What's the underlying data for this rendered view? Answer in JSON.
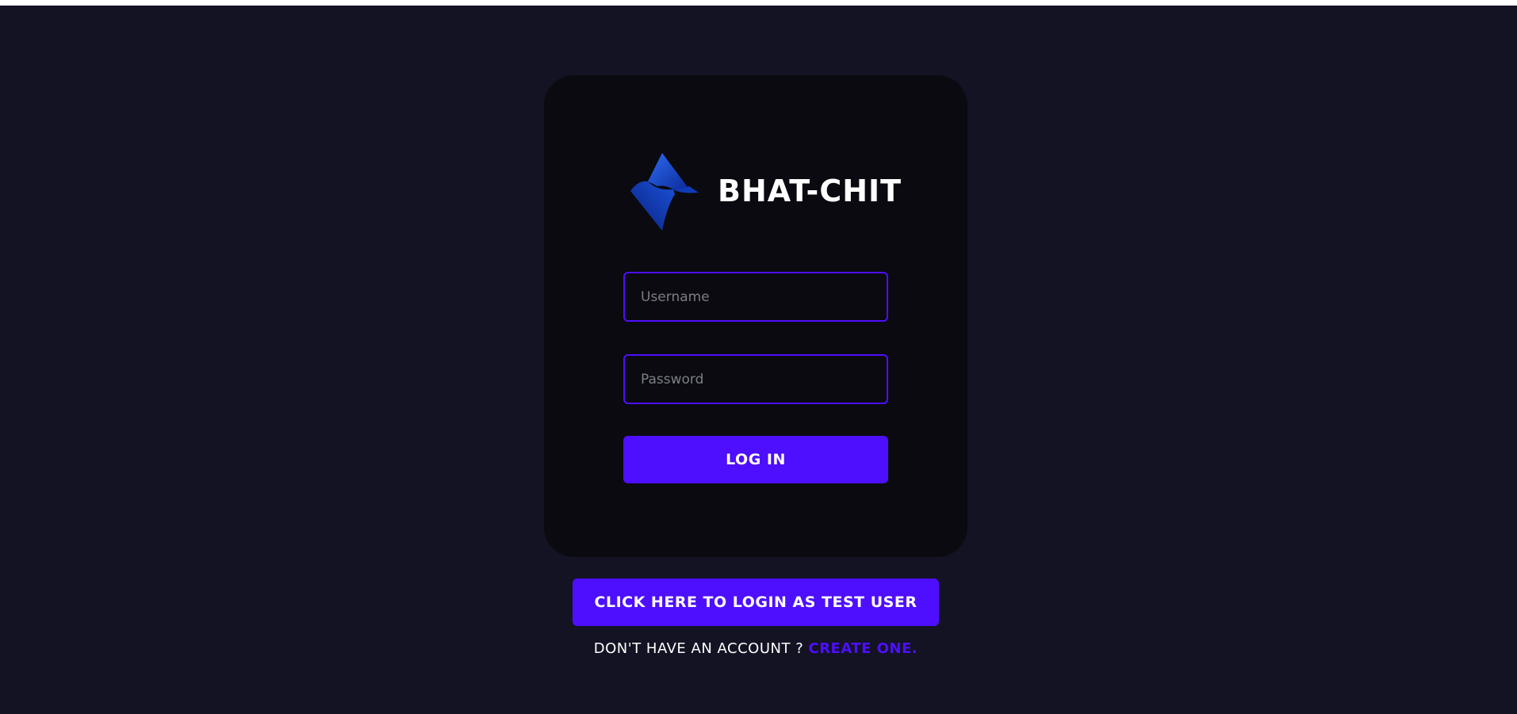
{
  "brand": {
    "title": "BHAT-CHIT",
    "logo_icon": "diamond-s-logo"
  },
  "form": {
    "username": {
      "value": "",
      "placeholder": "Username"
    },
    "password": {
      "value": "",
      "placeholder": "Password"
    },
    "login_label": "LOG IN"
  },
  "test_user_label": "CLICK HERE TO LOGIN AS TEST USER",
  "signup": {
    "prompt": "DON'T HAVE AN ACCOUNT ?",
    "link_label": "CREATE ONE."
  },
  "colors": {
    "background": "#131324",
    "card": "#0a0a10",
    "accent": "#4e0eff",
    "text": "#ffffff",
    "placeholder": "#7d7d86"
  }
}
